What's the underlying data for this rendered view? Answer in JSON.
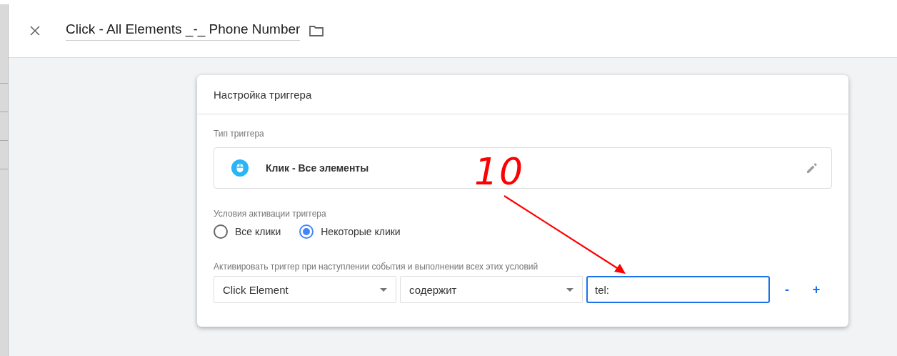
{
  "header": {
    "title": "Click - All Elements _-_ Phone Number"
  },
  "card": {
    "title": "Настройка триггера",
    "trigger_type": {
      "label": "Тип триггера",
      "value": "Клик - Все элементы"
    },
    "activation": {
      "label": "Условия активации триггера",
      "options": [
        {
          "label": "Все клики",
          "selected": false
        },
        {
          "label": "Некоторые клики",
          "selected": true
        }
      ]
    },
    "condition": {
      "label": "Активировать триггер при наступлении события и выполнении всех этих условий",
      "variable": "Click Element",
      "operator": "содержит",
      "value": "tel:",
      "remove": "-",
      "add": "+"
    }
  },
  "annotation": {
    "text": "10"
  }
}
